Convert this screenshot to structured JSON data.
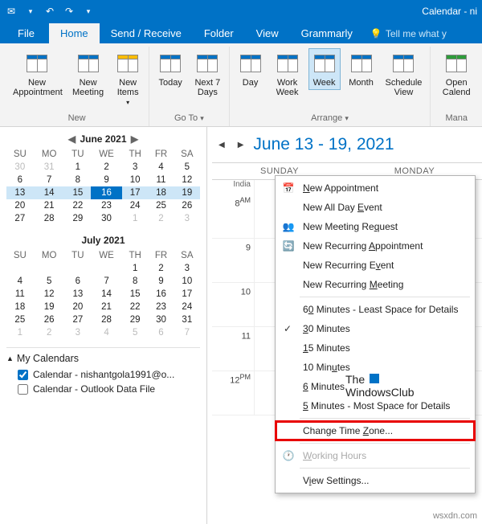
{
  "titlebar": {
    "title": "Calendar - ni"
  },
  "tabs": {
    "file": "File",
    "home": "Home",
    "sendreceive": "Send / Receive",
    "folder": "Folder",
    "view": "View",
    "grammarly": "Grammarly",
    "tellme": "Tell me what y"
  },
  "ribbon": {
    "new_appt": "New Appointment",
    "new_meeting": "New Meeting",
    "new_items": "New Items",
    "today": "Today",
    "next7": "Next 7 Days",
    "day": "Day",
    "workweek": "Work Week",
    "week": "Week",
    "month": "Month",
    "schedule": "Schedule View",
    "open_cal": "Open Calend",
    "grp_new": "New",
    "grp_goto": "Go To",
    "grp_arrange": "Arrange",
    "grp_mana": "Mana"
  },
  "minical1": {
    "title": "June 2021",
    "dow": [
      "SU",
      "MO",
      "TU",
      "WE",
      "TH",
      "FR",
      "SA"
    ],
    "rows": [
      [
        {
          "d": "30",
          "o": 1
        },
        {
          "d": "31",
          "o": 1
        },
        {
          "d": "1"
        },
        {
          "d": "2"
        },
        {
          "d": "3"
        },
        {
          "d": "4"
        },
        {
          "d": "5"
        }
      ],
      [
        {
          "d": "6"
        },
        {
          "d": "7"
        },
        {
          "d": "8"
        },
        {
          "d": "9"
        },
        {
          "d": "10"
        },
        {
          "d": "11"
        },
        {
          "d": "12"
        }
      ],
      [
        {
          "d": "13",
          "h": 1
        },
        {
          "d": "14",
          "h": 1
        },
        {
          "d": "15",
          "h": 1
        },
        {
          "d": "16",
          "t": 1
        },
        {
          "d": "17",
          "h": 1
        },
        {
          "d": "18",
          "h": 1
        },
        {
          "d": "19",
          "h": 1
        }
      ],
      [
        {
          "d": "20"
        },
        {
          "d": "21"
        },
        {
          "d": "22"
        },
        {
          "d": "23"
        },
        {
          "d": "24"
        },
        {
          "d": "25"
        },
        {
          "d": "26"
        }
      ],
      [
        {
          "d": "27"
        },
        {
          "d": "28"
        },
        {
          "d": "29"
        },
        {
          "d": "30"
        },
        {
          "d": "1",
          "o": 1
        },
        {
          "d": "2",
          "o": 1
        },
        {
          "d": "3",
          "o": 1
        }
      ]
    ]
  },
  "minical2": {
    "title": "July 2021",
    "dow": [
      "SU",
      "MO",
      "TU",
      "WE",
      "TH",
      "FR",
      "SA"
    ],
    "rows": [
      [
        {
          "d": ""
        },
        {
          "d": ""
        },
        {
          "d": ""
        },
        {
          "d": ""
        },
        {
          "d": "1"
        },
        {
          "d": "2"
        },
        {
          "d": "3"
        }
      ],
      [
        {
          "d": "4"
        },
        {
          "d": "5"
        },
        {
          "d": "6"
        },
        {
          "d": "7"
        },
        {
          "d": "8"
        },
        {
          "d": "9"
        },
        {
          "d": "10"
        }
      ],
      [
        {
          "d": "11"
        },
        {
          "d": "12"
        },
        {
          "d": "13"
        },
        {
          "d": "14"
        },
        {
          "d": "15"
        },
        {
          "d": "16"
        },
        {
          "d": "17"
        }
      ],
      [
        {
          "d": "18"
        },
        {
          "d": "19"
        },
        {
          "d": "20"
        },
        {
          "d": "21"
        },
        {
          "d": "22"
        },
        {
          "d": "23"
        },
        {
          "d": "24"
        }
      ],
      [
        {
          "d": "25"
        },
        {
          "d": "26"
        },
        {
          "d": "27"
        },
        {
          "d": "28"
        },
        {
          "d": "29"
        },
        {
          "d": "30"
        },
        {
          "d": "31"
        }
      ],
      [
        {
          "d": "1",
          "o": 1
        },
        {
          "d": "2",
          "o": 1
        },
        {
          "d": "3",
          "o": 1
        },
        {
          "d": "4",
          "o": 1
        },
        {
          "d": "5",
          "o": 1
        },
        {
          "d": "6",
          "o": 1
        },
        {
          "d": "7",
          "o": 1
        }
      ]
    ]
  },
  "mycals": {
    "title": "My Calendars",
    "items": [
      {
        "checked": true,
        "label": "Calendar - nishantgola1991@o..."
      },
      {
        "checked": false,
        "label": "Calendar - Outlook Data File"
      }
    ]
  },
  "calview": {
    "range": "June 13 - 19, 2021",
    "day_headers": [
      "SUNDAY",
      "MONDAY"
    ],
    "tz": "India",
    "times": [
      "8",
      "9",
      "10",
      "11",
      "12"
    ],
    "ampm": [
      "AM",
      "",
      "",
      "",
      "PM"
    ]
  },
  "context": {
    "new_appt": "New Appointment",
    "new_allday": "New All Day Event",
    "new_meeting": "New Meeting Request",
    "new_recur_appt": "New Recurring Appointment",
    "new_recur_event": "New Recurring Event",
    "new_recur_meeting": "New Recurring Meeting",
    "min60": "60 Minutes - Least Space for Details",
    "min30": "30 Minutes",
    "min15": "15 Minutes",
    "min10": "10 Minutes",
    "min6": "6 Minutes",
    "min5": "5 Minutes - Most Space for Details",
    "change_tz": "Change Time Zone...",
    "working_hours": "Working Hours",
    "view_settings": "View Settings..."
  },
  "watermark": {
    "l1": "The",
    "l2": "WindowsClub"
  },
  "footer": "wsxdn.com"
}
